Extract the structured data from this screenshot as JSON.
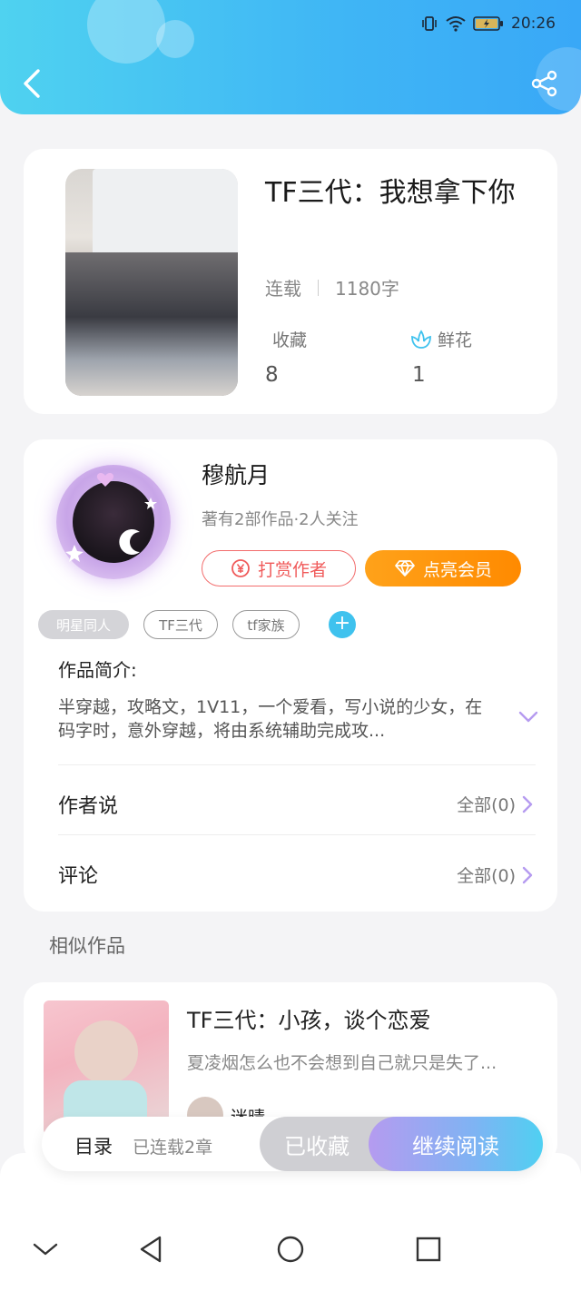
{
  "status_bar": {
    "time": "20:26"
  },
  "book": {
    "title": "TF三代：我想拿下你",
    "status": "连载",
    "word_count": "1180字",
    "favorites_label": "收藏",
    "favorites_count": "8",
    "flowers_label": "鲜花",
    "flowers_count": "1"
  },
  "author": {
    "name": "穆航月",
    "subtitle": "著有2部作品·2人关注",
    "reward_button": "打赏作者",
    "vip_button": "点亮会员"
  },
  "tags": [
    "明星同人",
    "TF三代",
    "tf家族"
  ],
  "intro": {
    "label": "作品简介:",
    "text": "半穿越，攻略文，1V11，一个爱看，写小说的少女，在码字时，意外穿越，将由系统辅助完成攻..."
  },
  "rows": {
    "author_says": {
      "label": "作者说",
      "value": "全部(0)"
    },
    "comments": {
      "label": "评论",
      "value": "全部(0)"
    }
  },
  "similar": {
    "section_title": "相似作品",
    "items": [
      {
        "title": "TF三代：小孩，谈个恋爱",
        "desc": "夏凌烟怎么也不会想到自己就只是失了...",
        "author": "迷晴"
      }
    ]
  },
  "action_bar": {
    "toc": "目录",
    "chapters": "已连载2章",
    "collected": "已收藏",
    "continue": "继续阅读"
  },
  "colors": {
    "header_start": "#4fd2f0",
    "header_end": "#39a8f7",
    "vip_orange": "#ff8a00",
    "reward_red": "#f05a5a",
    "accent_purple": "#b59bf0"
  }
}
